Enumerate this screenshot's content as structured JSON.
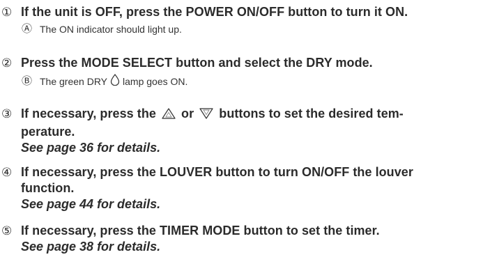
{
  "steps": [
    {
      "num": "①",
      "text": "If the unit is OFF, press the POWER ON/OFF button to turn it ON.",
      "sub": {
        "letter": "Ⓐ",
        "text": "The ON indicator should light up."
      }
    },
    {
      "num": "②",
      "text": "Press the MODE SELECT button and select the DRY mode.",
      "sub": {
        "letter": "Ⓑ",
        "text_before": "The green DRY",
        "text_after": "lamp goes ON."
      }
    },
    {
      "num": "③",
      "text_1": "If necessary, press the",
      "text_or": "or",
      "text_2": "buttons to set the desired tem-",
      "line2": "perature.",
      "ref": "See page 36 for details."
    },
    {
      "num": "④",
      "line1": "If necessary, press the LOUVER button to turn ON/OFF the louver",
      "line2": "function.",
      "ref": "See page 44 for details."
    },
    {
      "num": "⑤",
      "line1": "If necessary, press the TIMER MODE button to set the timer.",
      "ref": "See page 38 for details."
    }
  ],
  "icons": {
    "up": "triangle-up-button-icon",
    "down": "triangle-down-button-icon",
    "drop": "dry-drop-lamp-icon"
  }
}
